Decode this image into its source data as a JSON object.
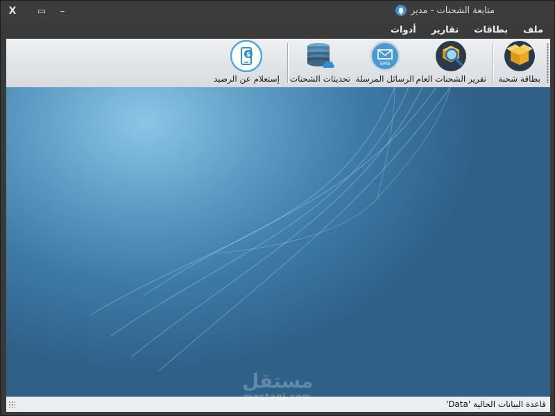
{
  "window": {
    "title": "متابعة الشحنات - مدير",
    "controls": {
      "close": "X",
      "maximize": "▭",
      "minimize": "–"
    }
  },
  "menu": [
    {
      "label": "ملف"
    },
    {
      "label": "بطاقات"
    },
    {
      "label": "تقارير"
    },
    {
      "label": "أدوات"
    }
  ],
  "toolbar": {
    "items": [
      {
        "label": "بطاقة شحنة",
        "icon": "open-box-icon"
      },
      {
        "label": "تقرير الشحنات العام",
        "icon": "box-search-icon"
      },
      {
        "label": "الرسائل المرسلة",
        "icon": "sms-envelope-icon"
      },
      {
        "label": "تحديثات الشحنات",
        "icon": "database-cloud-icon"
      },
      {
        "label": "إستعلام عن الرصيد",
        "icon": "phone-dollar-icon"
      }
    ]
  },
  "status": {
    "text": "قاعدة البيانات الحالية 'Data'"
  },
  "watermark": {
    "main": "مستقل",
    "sub": "mostaql.com"
  },
  "colors": {
    "accent": "#3d8fd6",
    "titlebar": "#3c3c3c",
    "desktop": "#3e7aa7"
  }
}
